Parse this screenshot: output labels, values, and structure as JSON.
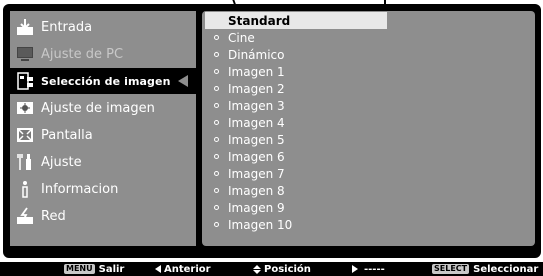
{
  "menu": {
    "items": [
      {
        "label": "Entrada",
        "icon": "input-icon",
        "state": "normal"
      },
      {
        "label": "Ajuste de PC",
        "icon": "pc-icon",
        "state": "disabled"
      },
      {
        "label": "Selección de imagen",
        "icon": "image-select-icon",
        "state": "selected"
      },
      {
        "label": "Ajuste de imagen",
        "icon": "image-adjust-icon",
        "state": "normal"
      },
      {
        "label": "Pantalla",
        "icon": "screen-icon",
        "state": "normal"
      },
      {
        "label": "Ajuste",
        "icon": "setting-icon",
        "state": "normal"
      },
      {
        "label": "Informacion",
        "icon": "info-icon",
        "state": "normal"
      },
      {
        "label": "Red",
        "icon": "network-icon",
        "state": "normal"
      }
    ]
  },
  "options": {
    "selected_index": 0,
    "items": [
      "Standard",
      "Cine",
      "Dinámico",
      "Imagen 1",
      "Imagen 2",
      "Imagen 3",
      "Imagen 4",
      "Imagen 5",
      "Imagen 6",
      "Imagen 7",
      "Imagen 8",
      "Imagen 9",
      "Imagen 10"
    ]
  },
  "footer": {
    "menu_tag": "MENU",
    "exit_label": "Salir",
    "back_label": "Anterior",
    "position_label": "Posición",
    "next_label": "-----",
    "select_tag": "SELECT",
    "select_label": "Seleccionar"
  },
  "colors": {
    "panel": "#8e8e8e",
    "background": "#000000",
    "highlight": "#e8e8e8"
  }
}
